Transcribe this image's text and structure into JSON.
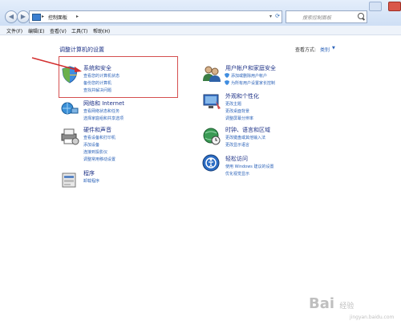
{
  "address_bar": {
    "path": "控制面板",
    "refresh_icon": "refresh-icon"
  },
  "search": {
    "placeholder": "搜索控制面板"
  },
  "menu": [
    "文件(F)",
    "编辑(E)",
    "查看(V)",
    "工具(T)",
    "帮助(H)"
  ],
  "heading": "调整计算机的设置",
  "view_by": {
    "label": "查看方式:",
    "value": "类别"
  },
  "categories": [
    {
      "title": "系统和安全",
      "icon": "shield-icon",
      "links": [
        "查看您的计算机状态",
        "备份您的计算机",
        "查找并解决问题"
      ]
    },
    {
      "title": "网络和 Internet",
      "icon": "network-icon",
      "links": [
        "查看网络状态和任务",
        "选择家庭组和共享选项"
      ]
    },
    {
      "title": "硬件和声音",
      "icon": "printer-icon",
      "links": [
        "查看设备和打印机",
        "添加设备",
        "连接到投影仪",
        "调整常用移动设置"
      ]
    },
    {
      "title": "程序",
      "icon": "programs-icon",
      "links": [
        "卸载程序"
      ]
    },
    {
      "title": "用户帐户和家庭安全",
      "icon": "users-icon",
      "links": [
        "添加或删除用户帐户",
        "为所有用户设置家长控制"
      ]
    },
    {
      "title": "外观和个性化",
      "icon": "appearance-icon",
      "links": [
        "更改主题",
        "更改桌面背景",
        "调整屏幕分辨率"
      ]
    },
    {
      "title": "时钟、语言和区域",
      "icon": "globe-clock-icon",
      "links": [
        "更改键盘或其他输入法",
        "更改显示语言"
      ]
    },
    {
      "title": "轻松访问",
      "icon": "ease-access-icon",
      "links": [
        "使用 Windows 建议的设置",
        "优化视觉显示"
      ]
    }
  ],
  "watermark": {
    "text": "Bai",
    "sub": "经验",
    "url": "jingyan.baidu.com"
  },
  "colors": {
    "link": "#2c63b9",
    "title": "#1e3287",
    "highlight": "#d55050"
  }
}
